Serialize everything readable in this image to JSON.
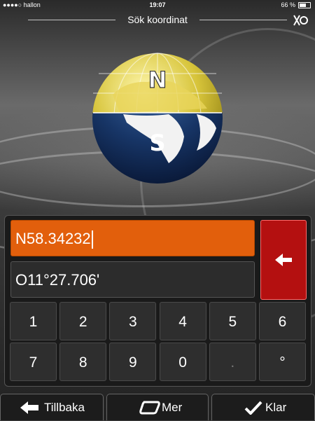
{
  "statusbar": {
    "carrier": "●●●●○ hallon",
    "time": "19:07",
    "battery": "66 %",
    "battery_level": 0.66
  },
  "header": {
    "title": "Sök koordinat",
    "gps_icon": "no-gps-icon"
  },
  "globe": {
    "north_label": "N",
    "south_label": "S"
  },
  "input": {
    "latitude": "N58.34232",
    "longitude": "O11°27.706'"
  },
  "keypad": {
    "row1": [
      "1",
      "2",
      "3",
      "4",
      "5",
      "6"
    ],
    "row2": [
      "7",
      "8",
      "9",
      "0",
      ".",
      "°"
    ]
  },
  "bottom": {
    "back_label": "Tillbaka",
    "more_label": "Mer",
    "done_label": "Klar"
  },
  "colors": {
    "active_field": "#e25f0c",
    "backspace": "#b41010"
  }
}
